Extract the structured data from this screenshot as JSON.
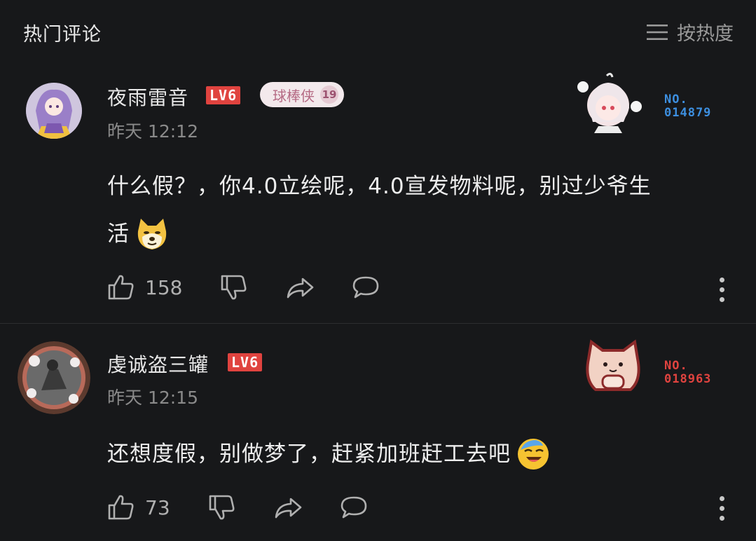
{
  "header": {
    "title": "热门评论",
    "sort_label": "按热度"
  },
  "comments": [
    {
      "username": "夜雨雷音",
      "level": "LV6",
      "fan_badge": {
        "name": "球棒侠",
        "level": "19"
      },
      "time": "昨天 12:12",
      "content_line1": "什么假？，你4.0立绘呢，4.0宣发物料呢，别过少爷生",
      "content_line2": "活",
      "emoji": "doge-emoji",
      "likes": "158",
      "deco_no_label": "NO.",
      "deco_no_value": "014879",
      "deco_color": "#3d8fe0"
    },
    {
      "username": "虔诚盗三罐",
      "level": "LV6",
      "time": "昨天 12:15",
      "content_line1": "还想度假，别做梦了，赶紧加班赶工去吧",
      "emoji": "crying-laughing-emoji",
      "likes": "73",
      "deco_no_label": "NO.",
      "deco_no_value": "018963",
      "deco_color": "#e0433f"
    }
  ]
}
